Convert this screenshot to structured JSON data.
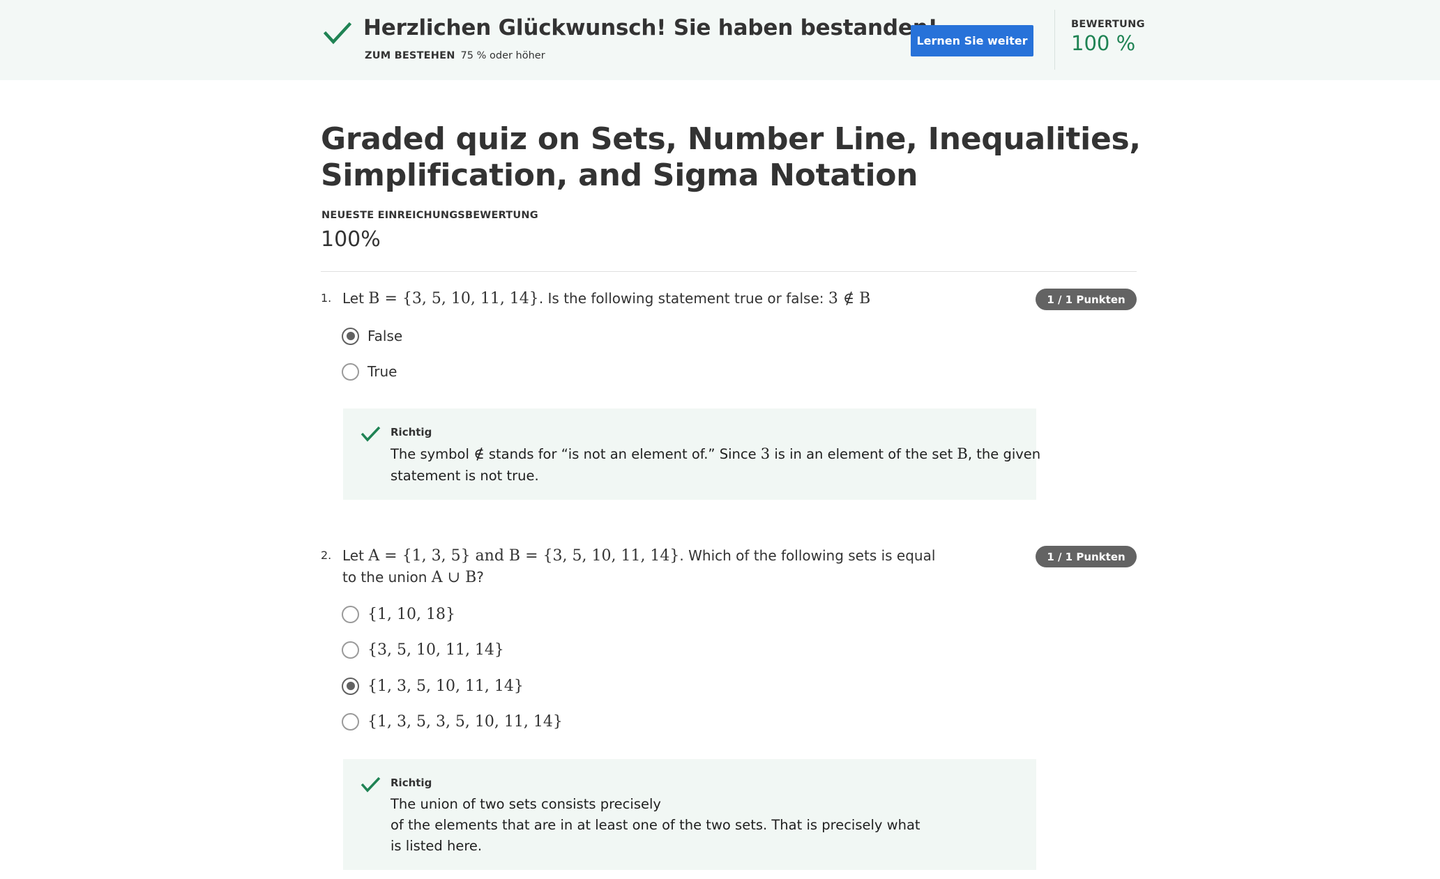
{
  "banner": {
    "title": "Herzlichen Glückwunsch! Sie haben bestanden!",
    "pass_label": "ZUM BESTEHEN",
    "pass_value": "75 % oder höher",
    "continue_label": "Lernen Sie weiter",
    "grade_label": "BEWERTUNG",
    "grade_value": "100 %",
    "accent_color": "#1f8354",
    "button_color": "#2772d9"
  },
  "page": {
    "title": "Graded quiz on Sets, Number Line, Inequalities, Simplification, and Sigma Notation",
    "latest_label": "NEUESTE EINREICHUNGSBEWERTUNG",
    "latest_value": "100%"
  },
  "questions": [
    {
      "number": "1.",
      "text_before": "Let ",
      "math_1": "B = {3, 5, 10, 11, 14}",
      "text_after": ". Is the following statement true or false: ",
      "math_2": "3 ∉ B",
      "points": "1 / 1 Punkten",
      "options": [
        {
          "label": "False",
          "selected": true
        },
        {
          "label": "True",
          "selected": false
        }
      ],
      "feedback": {
        "label": "Richtig",
        "part_1": "The symbol ",
        "math_1": "∉",
        "part_2": " stands for “is not an element of.” Since ",
        "math_2": "3",
        "part_3": " is in an element of the set ",
        "math_3": "B",
        "part_4": ", the given",
        "line_2": "statement is not true."
      }
    },
    {
      "number": "2.",
      "text_before": "Let ",
      "math_1": "A = {1, 3, 5} and B = {3, 5, 10, 11, 14}",
      "text_after": ". Which of the following sets is equal",
      "line_2_before": "to the union ",
      "math_2": "A ∪ B",
      "line_2_after": "?",
      "points": "1 / 1 Punkten",
      "options": [
        {
          "label": "{1, 10, 18}",
          "selected": false
        },
        {
          "label": "{3, 5, 10, 11, 14}",
          "selected": false
        },
        {
          "label": "{1, 3, 5, 10, 11, 14}",
          "selected": true
        },
        {
          "label": "{1, 3, 5, 3, 5, 10, 11, 14}",
          "selected": false
        }
      ],
      "feedback": {
        "label": "Richtig",
        "line_1": "The union of two sets consists precisely",
        "line_2": "of the elements that are in at least one of the two sets. That is precisely what",
        "line_3": "is listed here."
      }
    }
  ]
}
